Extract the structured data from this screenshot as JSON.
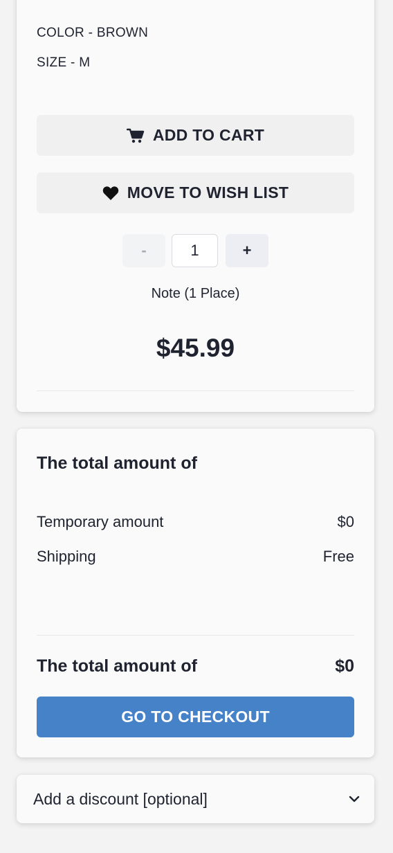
{
  "product": {
    "color_label": "COLOR - BROWN",
    "size_label": "SIZE - M",
    "add_to_cart_label": "ADD TO CART",
    "wishlist_label": "MOVE TO WISH LIST",
    "quantity": {
      "minus_label": "-",
      "value": "1",
      "plus_label": "+"
    },
    "note": "Note (1 Place)",
    "price": "$45.99"
  },
  "summary": {
    "title": "The total amount of",
    "rows": [
      {
        "label": "Temporary amount",
        "value": "$0"
      },
      {
        "label": "Shipping",
        "value": "Free"
      }
    ],
    "total_label": "The total amount of",
    "total_value": "$0",
    "checkout_label": "GO TO CHECKOUT"
  },
  "discount": {
    "label": "Add a discount [optional]"
  },
  "icons": {
    "cart": "cart-icon",
    "heart": "heart-icon",
    "chevron": "chevron-down-icon"
  },
  "colors": {
    "accent": "#4682c8",
    "text": "#1f2330",
    "button_gray": "#f0f0f0"
  }
}
